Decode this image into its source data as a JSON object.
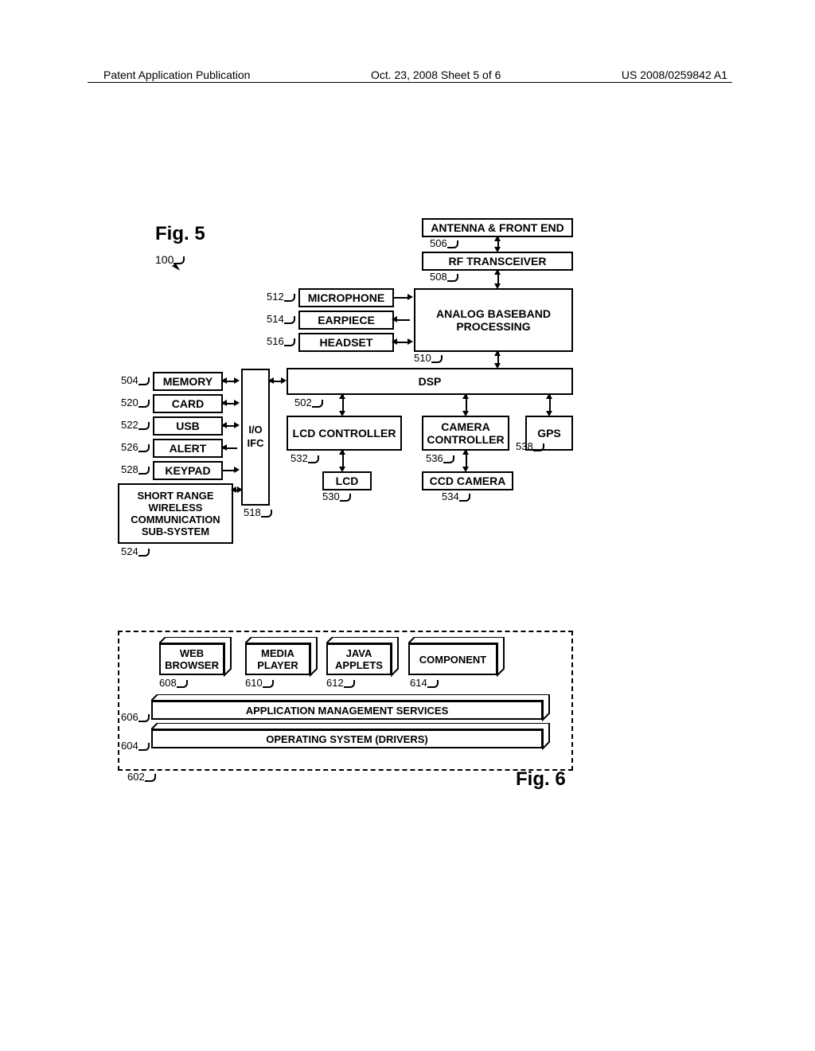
{
  "header": {
    "left": "Patent Application Publication",
    "center": "Oct. 23, 2008  Sheet 5 of 6",
    "right": "US 2008/0259842 A1"
  },
  "fig5": {
    "title": "Fig. 5",
    "ref_100": "100",
    "blocks": {
      "antenna": "ANTENNA & FRONT END",
      "rf": "RF TRANSCEIVER",
      "microphone": "MICROPHONE",
      "earpiece": "EARPIECE",
      "headset": "HEADSET",
      "analog": "ANALOG BASEBAND PROCESSING",
      "memory": "MEMORY",
      "card": "CARD",
      "usb": "USB",
      "alert": "ALERT",
      "keypad": "KEYPAD",
      "short_range": "SHORT RANGE WIRELESS COMMUNICATION SUB-SYSTEM",
      "io": "I/O IFC",
      "dsp": "DSP",
      "lcd_ctrl": "LCD CONTROLLER",
      "camera_ctrl": "CAMERA CONTROLLER",
      "gps": "GPS",
      "lcd": "LCD",
      "ccd": "CCD CAMERA"
    },
    "refs": {
      "502": "502",
      "504": "504",
      "506": "506",
      "508": "508",
      "510": "510",
      "512": "512",
      "514": "514",
      "516": "516",
      "518": "518",
      "520": "520",
      "522": "522",
      "524": "524",
      "526": "526",
      "528": "528",
      "530": "530",
      "532": "532",
      "534": "534",
      "536": "536",
      "538": "538"
    }
  },
  "fig6": {
    "title": "Fig. 6",
    "blocks": {
      "web": "WEB BROWSER",
      "media": "MEDIA PLAYER",
      "java": "JAVA APPLETS",
      "component": "COMPONENT",
      "ams": "APPLICATION MANAGEMENT SERVICES",
      "os": "OPERATING SYSTEM (DRIVERS)"
    },
    "refs": {
      "602": "602",
      "604": "604",
      "606": "606",
      "608": "608",
      "610": "610",
      "612": "612",
      "614": "614"
    }
  }
}
